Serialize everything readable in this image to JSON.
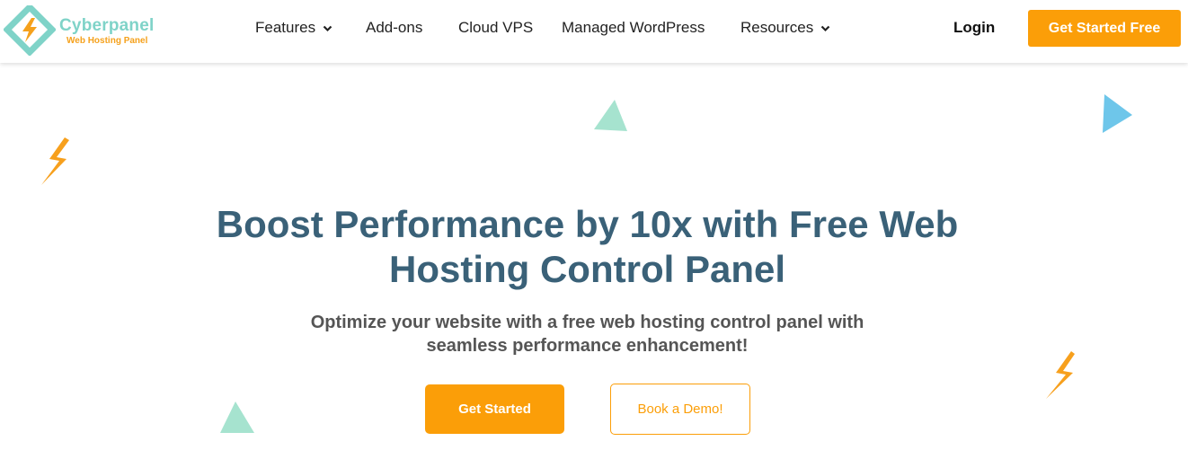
{
  "brand": {
    "name": "Cyberpanel",
    "tagline": "Web Hosting Panel",
    "logo_icon": "cyberpanel-logo-icon",
    "colors": {
      "teal": "#7fd3c8",
      "orange": "#f5a11c"
    }
  },
  "nav": {
    "items": [
      {
        "label": "Features",
        "has_dropdown": true
      },
      {
        "label": "Add-ons",
        "has_dropdown": false
      },
      {
        "label": "Cloud VPS",
        "has_dropdown": false
      },
      {
        "label": "Managed WordPress",
        "has_dropdown": false
      },
      {
        "label": "Resources",
        "has_dropdown": true
      }
    ],
    "login_label": "Login",
    "cta_label": "Get Started Free"
  },
  "hero": {
    "title_line1": "Boost Performance by 10x with Free Web",
    "title_line2": "Hosting Control Panel",
    "subtitle_line1": "Optimize your website with a free web hosting control panel with",
    "subtitle_line2": "seamless performance enhancement!",
    "primary_button": "Get Started",
    "secondary_button": "Book a Demo!"
  },
  "theme": {
    "accent": "#fb9e08",
    "title_color": "#3a6178",
    "subtitle_color": "#555555",
    "decoration_colors": [
      "#a6e3cf",
      "#6ec6ea",
      "#f7a01d"
    ]
  }
}
